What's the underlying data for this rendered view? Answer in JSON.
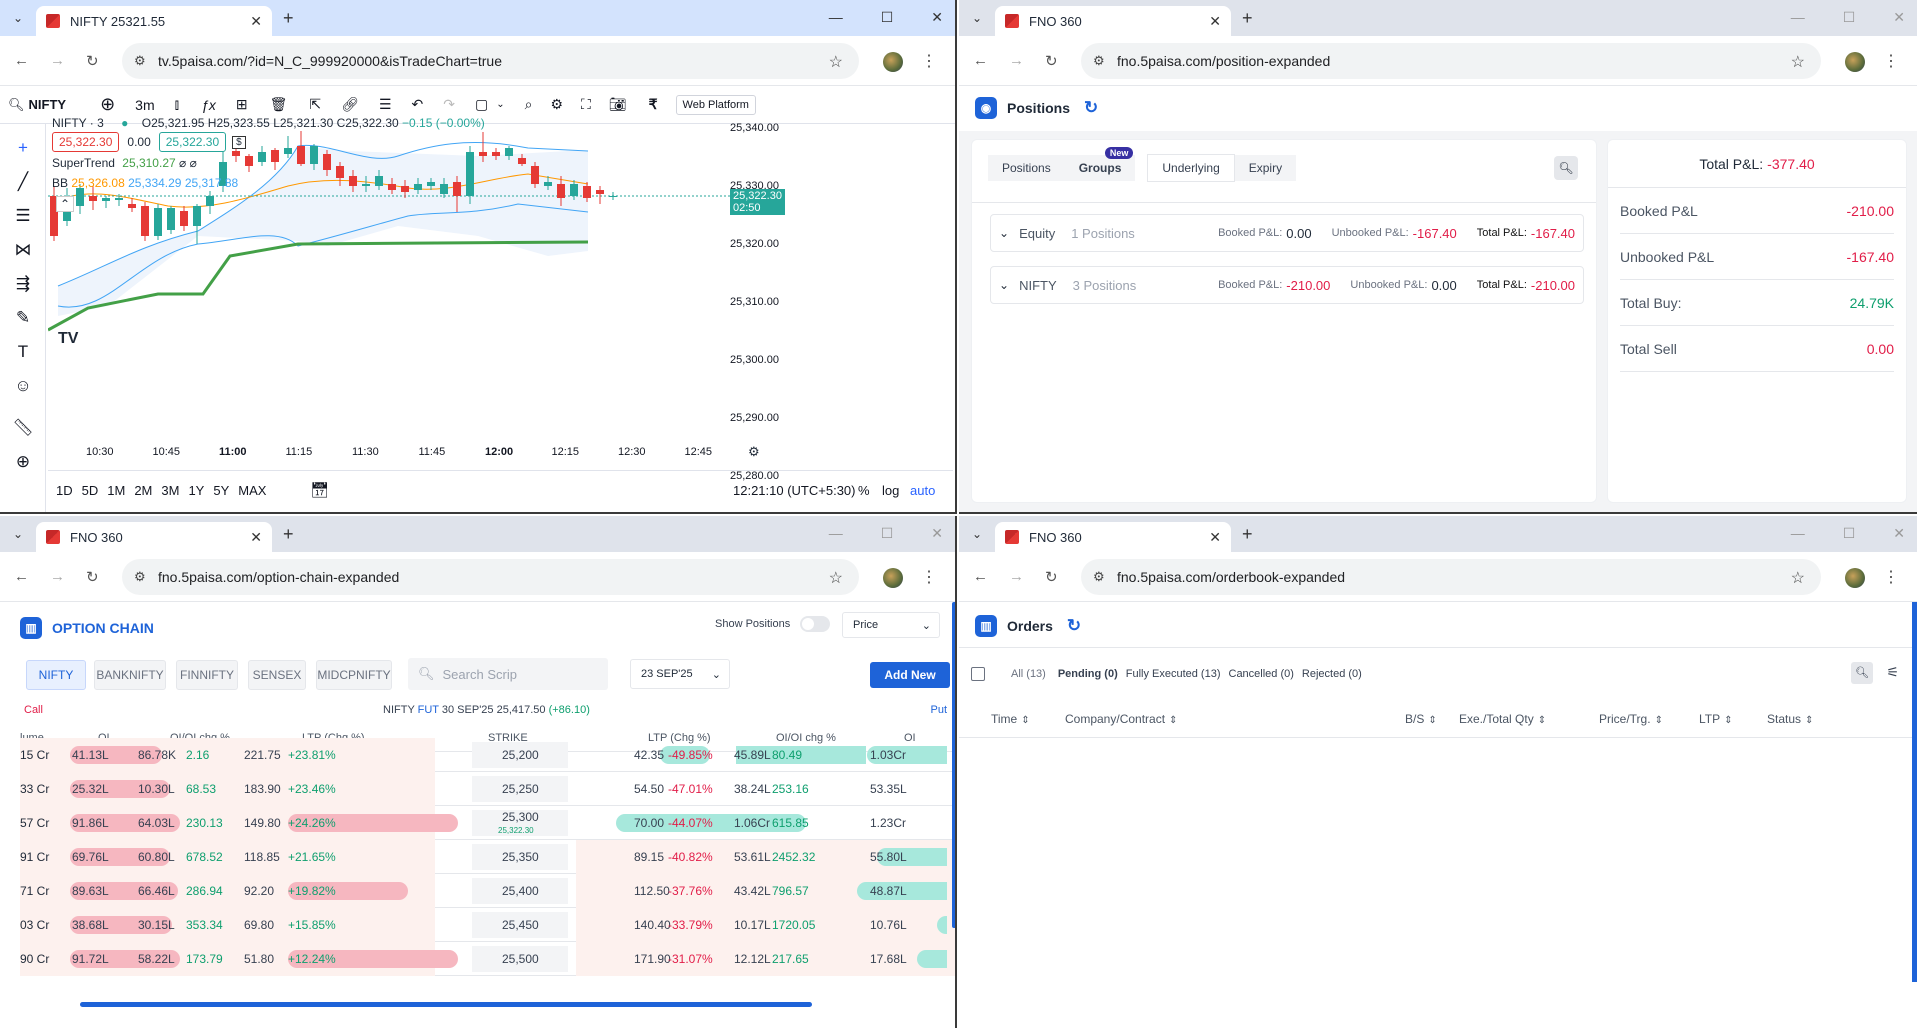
{
  "browser": {
    "menu_icon": "chevron-down-icon",
    "new_tab": "+",
    "min": "—",
    "max": "☐",
    "close": "✕"
  },
  "w1": {
    "tab_title": "NIFTY 25321.55",
    "url": "tv.5paisa.com/?id=N_C_999920000&isTradeChart=true",
    "symbol": "NIFTY",
    "interval": "3m",
    "web_platform": "Web Platform",
    "legend_symbol": "NIFTY · 3",
    "ohlc": {
      "o": "O25,321.95",
      "h": "H25,323.55",
      "l": "L25,321.30",
      "c": "C25,322.30",
      "chg": "−0.15 (−0.00%)"
    },
    "bid": "25,322.30",
    "spread": "0.00",
    "ask": "25,322.30",
    "supertrend_label": "SuperTrend",
    "supertrend_val": "25,310.27",
    "bb_label": "BB",
    "bb1": "25,326.08",
    "bb2": "25,334.29",
    "bb3": "25,317.88",
    "price_ticks": [
      "25,340.00",
      "25,330.00",
      "25,320.00",
      "25,310.00",
      "25,300.00",
      "25,290.00",
      "25,280.00"
    ],
    "time_ticks": [
      "10:30",
      "10:45",
      "11:00",
      "11:15",
      "11:30",
      "11:45",
      "12:00",
      "12:15",
      "12:30",
      "12:45"
    ],
    "last_price": "25,322.30",
    "countdown": "02:50",
    "ranges": [
      "1D",
      "5D",
      "1M",
      "2M",
      "3M",
      "1Y",
      "5Y",
      "MAX"
    ],
    "clock": "12:21:10 (UTC+5:30)",
    "pct": "%",
    "log": "log",
    "auto": "auto"
  },
  "w2": {
    "tab_title": "FNO 360",
    "url": "fno.5paisa.com/position-expanded",
    "title": "Positions",
    "tabs": [
      "Positions",
      "Groups",
      "Underlying",
      "Expiry"
    ],
    "new_badge": "New",
    "groups": [
      {
        "name": "Equity",
        "count": "1 Positions",
        "booked_label": "Booked P&L:",
        "booked": "0.00",
        "unbooked_label": "Unbooked P&L:",
        "unbooked": "-167.40",
        "total_label": "Total P&L:",
        "total": "-167.40"
      },
      {
        "name": "NIFTY",
        "count": "3 Positions",
        "booked_label": "Booked P&L:",
        "booked": "-210.00",
        "unbooked_label": "Unbooked P&L:",
        "unbooked": "0.00",
        "total_label": "Total P&L:",
        "total": "-210.00"
      }
    ],
    "total_pnl_label": "Total P&L:",
    "total_pnl": "-377.40",
    "summary": [
      {
        "label": "Booked P&L",
        "value": "-210.00"
      },
      {
        "label": "Unbooked P&L",
        "value": "-167.40"
      },
      {
        "label": "Total Buy:",
        "value": "24.79K"
      },
      {
        "label": "Total Sell",
        "value": "0.00"
      }
    ]
  },
  "w3": {
    "tab_title": "FNO 360",
    "url": "fno.5paisa.com/option-chain-expanded",
    "title": "OPTION CHAIN",
    "show_positions": "Show Positions",
    "price_select": "Price",
    "indices": [
      "NIFTY",
      "BANKNIFTY",
      "FINNIFTY",
      "SENSEX",
      "MIDCPNIFTY"
    ],
    "search_placeholder": "Search Scrip",
    "expiry": "23 SEP'25",
    "add_new": "Add New",
    "call": "Call",
    "put": "Put",
    "fut_prefix": "NIFTY",
    "fut_label": "FUT",
    "fut_rest": "30 SEP'25  25,417.50",
    "fut_chg": "(+86.10)",
    "headers": [
      "lume",
      "OI",
      "OI/OI chg %",
      "LTP (Chg %)",
      "STRIKE",
      "LTP (Chg %)",
      "OI/OI chg %",
      "OI"
    ],
    "spot_under_strike": "25,322.30",
    "rows": [
      {
        "vol": "15 Cr",
        "oi": "41.13L",
        "oichg": "86.78K",
        "oipct": "2.16",
        "ltp": "221.75",
        "ltpchg": "+23.81%",
        "strike": "25,200",
        "pltp": "42.35",
        "pltpchg": "-49.85%",
        "poichg": "45.89L",
        "poipct": "80.49",
        "poi": "1.03Cr"
      },
      {
        "vol": "33 Cr",
        "oi": "25.32L",
        "oichg": "10.30L",
        "oipct": "68.53",
        "ltp": "183.90",
        "ltpchg": "+23.46%",
        "strike": "25,250",
        "pltp": "54.50",
        "pltpchg": "-47.01%",
        "poichg": "38.24L",
        "poipct": "253.16",
        "poi": "53.35L"
      },
      {
        "vol": "57 Cr",
        "oi": "91.86L",
        "oichg": "64.03L",
        "oipct": "230.13",
        "ltp": "149.80",
        "ltpchg": "+24.26%",
        "strike": "25,300",
        "pltp": "70.00",
        "pltpchg": "-44.07%",
        "poichg": "1.06Cr",
        "poipct": "615.85",
        "poi": "1.23Cr"
      },
      {
        "vol": "91 Cr",
        "oi": "69.76L",
        "oichg": "60.80L",
        "oipct": "678.52",
        "ltp": "118.85",
        "ltpchg": "+21.65%",
        "strike": "25,350",
        "pltp": "89.15",
        "pltpchg": "-40.82%",
        "poichg": "53.61L",
        "poipct": "2452.32",
        "poi": "55.80L"
      },
      {
        "vol": "71 Cr",
        "oi": "89.63L",
        "oichg": "66.46L",
        "oipct": "286.94",
        "ltp": "92.20",
        "ltpchg": "+19.82%",
        "strike": "25,400",
        "pltp": "112.50",
        "pltpchg": "-37.76%",
        "poichg": "43.42L",
        "poipct": "796.57",
        "poi": "48.87L"
      },
      {
        "vol": "03 Cr",
        "oi": "38.68L",
        "oichg": "30.15L",
        "oipct": "353.34",
        "ltp": "69.80",
        "ltpchg": "+15.85%",
        "strike": "25,450",
        "pltp": "140.40",
        "pltpchg": "-33.79%",
        "poichg": "10.17L",
        "poipct": "1720.05",
        "poi": "10.76L"
      },
      {
        "vol": "90 Cr",
        "oi": "91.72L",
        "oichg": "58.22L",
        "oipct": "173.79",
        "ltp": "51.80",
        "ltpchg": "+12.24%",
        "strike": "25,500",
        "pltp": "171.90",
        "pltpchg": "-31.07%",
        "poichg": "12.12L",
        "poipct": "217.65",
        "poi": "17.68L"
      }
    ]
  },
  "w4": {
    "tab_title": "FNO 360",
    "url": "fno.5paisa.com/orderbook-expanded",
    "title": "Orders",
    "tabs": [
      "All (13)",
      "Pending (0)",
      "Fully Executed (13)",
      "Cancelled (0)",
      "Rejected (0)"
    ],
    "columns": [
      "Time",
      "Company/Contract",
      "B/S",
      "Exe./Total Qty",
      "Price/Trg.",
      "LTP",
      "Status"
    ]
  }
}
